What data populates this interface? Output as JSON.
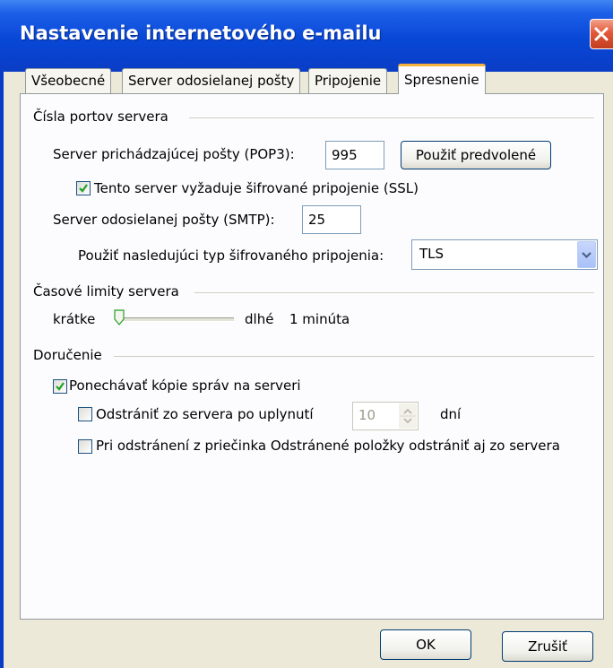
{
  "window": {
    "title": "Nastavenie internetového e-mailu"
  },
  "tabs": [
    {
      "label": "Všeobecné",
      "active": false
    },
    {
      "label": "Server odosielanej pošty",
      "active": false
    },
    {
      "label": "Pripojenie",
      "active": false
    },
    {
      "label": "Spresnenie",
      "active": true
    }
  ],
  "ports": {
    "group_label": "Čísla portov servera",
    "incoming_label": "Server prichádzajúcej pošty (POP3):",
    "incoming_value": "995",
    "default_button": "Použiť predvolené",
    "ssl_label": "Tento server vyžaduje šifrované pripojenie (SSL)",
    "ssl_checked": true,
    "outgoing_label": "Server odosielanej pošty (SMTP):",
    "outgoing_value": "25",
    "encryption_label": "Použiť nasledujúci typ šifrovaného pripojenia:",
    "encryption_value": "TLS"
  },
  "timeouts": {
    "group_label": "Časové limity servera",
    "short_label": "krátke",
    "long_label": "dlhé",
    "value_label": "1 minúta",
    "slider_level": 0.0
  },
  "delivery": {
    "group_label": "Doručenie",
    "keep_copies_label": "Ponechávať kópie správ na serveri",
    "keep_copies_checked": true,
    "remove_after_label": "Odstrániť zo servera po uplynutí",
    "remove_after_checked": false,
    "remove_after_value": "10",
    "days_label": "dní",
    "remove_deleted_label": "Pri odstránení z priečinka Odstránené položky odstrániť aj zo servera",
    "remove_deleted_checked": false
  },
  "footer": {
    "ok_label": "OK",
    "cancel_label": "Zrušiť"
  },
  "colors": {
    "titlebar": "#0a47d6",
    "dialog_bg": "#ece9d8",
    "active_tab_accent": "#f4b23c",
    "check_mark": "#21a121"
  }
}
